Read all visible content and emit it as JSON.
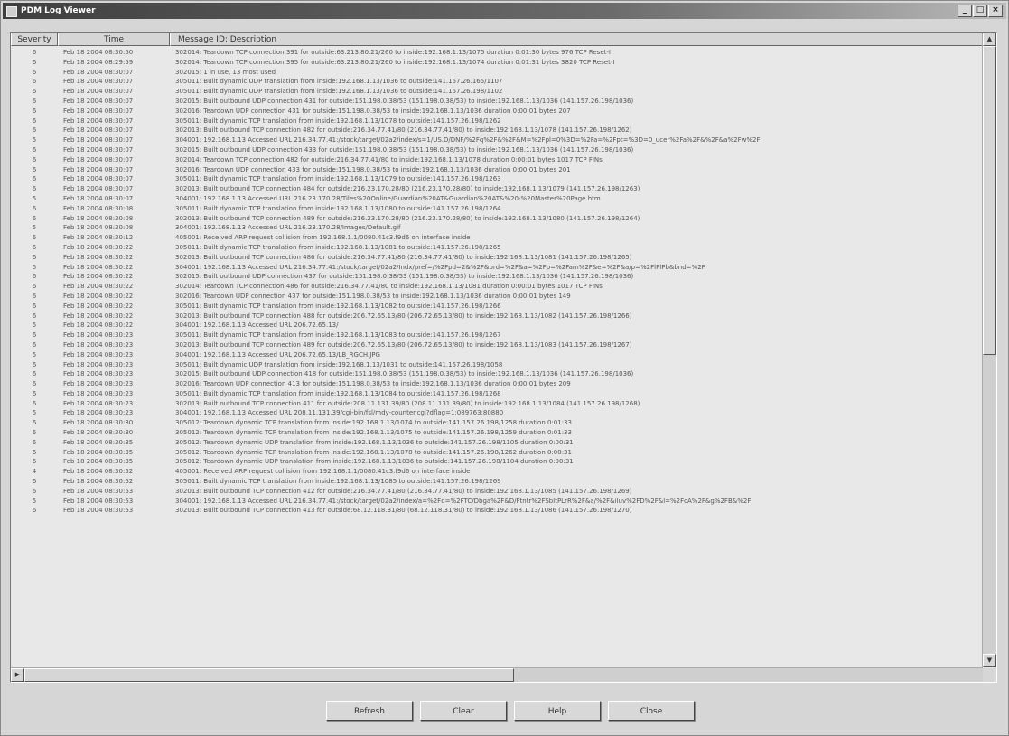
{
  "window": {
    "title": "PDM Log Viewer",
    "controls": {
      "minimize": "_",
      "maximize": "□",
      "close": "×"
    }
  },
  "columns": {
    "severity": "Severity",
    "time": "Time",
    "message": "Message ID: Description"
  },
  "rows": [
    {
      "sev": "6",
      "time": "Feb 18 2004 08:30:50",
      "msg": "302014: Teardown TCP connection 391 for outside:63.213.80.21/260 to inside:192.168.1.13/1075 duration 0:01:30 bytes 976 TCP Reset-I"
    },
    {
      "sev": "6",
      "time": "Feb 18 2004 08:29:59",
      "msg": "302014: Teardown TCP connection 395 for outside:63.213.80.21/260 to inside:192.168.1.13/1074 duration 0:01:31 bytes 3820 TCP Reset-I"
    },
    {
      "sev": "6",
      "time": "Feb 18 2004 08:30:07",
      "msg": "302015: 1 in use, 13 most used"
    },
    {
      "sev": "6",
      "time": "Feb 18 2004 08:30:07",
      "msg": "305011: Built dynamic UDP translation from inside:192.168.1.13/1036 to outside:141.157.26.165/1107"
    },
    {
      "sev": "6",
      "time": "Feb 18 2004 08:30:07",
      "msg": "305011: Built dynamic UDP translation from inside:192.168.1.13/1036 to outside:141.157.26.198/1102"
    },
    {
      "sev": "6",
      "time": "Feb 18 2004 08:30:07",
      "msg": "302015: Built outbound UDP connection 431 for outside:151.198.0.38/53 (151.198.0.38/53) to inside:192.168.1.13/1036 (141.157.26.198/1036)"
    },
    {
      "sev": "6",
      "time": "Feb 18 2004 08:30:07",
      "msg": "302016: Teardown UDP connection 431 for outside:151.198.0.38/53 to inside:192.168.1.13/1036 duration 0:00:01 bytes 207"
    },
    {
      "sev": "6",
      "time": "Feb 18 2004 08:30:07",
      "msg": "305011: Built dynamic TCP translation from inside:192.168.1.13/1078 to outside:141.157.26.198/1262"
    },
    {
      "sev": "6",
      "time": "Feb 18 2004 08:30:07",
      "msg": "302013: Built outbound TCP connection 482 for outside:216.34.77.41/80 (216.34.77.41/80) to inside:192.168.1.13/1078 (141.157.26.198/1262)"
    },
    {
      "sev": "5",
      "time": "Feb 18 2004 08:30:07",
      "msg": "304001: 192.168.1.13 Accessed URL 216.34.77.41:/stock/target/02a2/index/s=1/US.D/DNF/%2Fq%2F&%2F&M=%2Fpl=0%3D=%2Fa=%2Fpt=%3D=0_ucer%2Fa%2F&%2F&a%2Fw%2F"
    },
    {
      "sev": "6",
      "time": "Feb 18 2004 08:30:07",
      "msg": "302015: Built outbound UDP connection 433 for outside:151.198.0.38/53 (151.198.0.38/53) to inside:192.168.1.13/1036 (141.157.26.198/1036)"
    },
    {
      "sev": "6",
      "time": "Feb 18 2004 08:30:07",
      "msg": "302014: Teardown TCP connection 482 for outside:216.34.77.41/80 to inside:192.168.1.13/1078 duration 0:00:01 bytes 1017 TCP FINs"
    },
    {
      "sev": "6",
      "time": "Feb 18 2004 08:30:07",
      "msg": "302016: Teardown UDP connection 433 for outside:151.198.0.38/53 to inside:192.168.1.13/1036 duration 0:00:01 bytes 201"
    },
    {
      "sev": "6",
      "time": "Feb 18 2004 08:30:07",
      "msg": "305011: Built dynamic TCP translation from inside:192.168.1.13/1079 to outside:141.157.26.198/1263"
    },
    {
      "sev": "6",
      "time": "Feb 18 2004 08:30:07",
      "msg": "302013: Built outbound TCP connection 484 for outside:216.23.170.28/80 (216.23.170.28/80) to inside:192.168.1.13/1079 (141.157.26.198/1263)"
    },
    {
      "sev": "5",
      "time": "Feb 18 2004 08:30:07",
      "msg": "304001: 192.168.1.13 Accessed URL 216.23.170.28/Tiles%20Online/Guardian%20AT&Guardian%20AT&%20-%20Master%20Page.htm"
    },
    {
      "sev": "6",
      "time": "Feb 18 2004 08:30:08",
      "msg": "305011: Built dynamic TCP translation from inside:192.168.1.13/1080 to outside:141.157.26.198/1264"
    },
    {
      "sev": "6",
      "time": "Feb 18 2004 08:30:08",
      "msg": "302013: Built outbound TCP connection 489 for outside:216.23.170.28/80 (216.23.170.28/80) to inside:192.168.1.13/1080 (141.157.26.198/1264)"
    },
    {
      "sev": "5",
      "time": "Feb 18 2004 08:30:08",
      "msg": "304001: 192.168.1.13 Accessed URL 216.23.170.28/Images/Default.gif"
    },
    {
      "sev": "6",
      "time": "Feb 18 2004 08:30:12",
      "msg": "405001: Received ARP request collision from 192.168.1.1/0080.41c3.f9d6 on interface inside"
    },
    {
      "sev": "6",
      "time": "Feb 18 2004 08:30:22",
      "msg": "305011: Built dynamic TCP translation from inside:192.168.1.13/1081 to outside:141.157.26.198/1265"
    },
    {
      "sev": "6",
      "time": "Feb 18 2004 08:30:22",
      "msg": "302013: Built outbound TCP connection 486 for outside:216.34.77.41/80 (216.34.77.41/80) to inside:192.168.1.13/1081 (141.157.26.198/1265)"
    },
    {
      "sev": "5",
      "time": "Feb 18 2004 08:30:22",
      "msg": "304001: 192.168.1.13 Accessed URL 216.34.77.41:/stock/target/02a2/Indx/pref=/%2Fpd=2&%2F&prd=%2F&a=%2Fp=%2Fam%2F&e=%2F&a/p=%2FlPlPb&bnd=%2F"
    },
    {
      "sev": "6",
      "time": "Feb 18 2004 08:30:22",
      "msg": "302015: Built outbound UDP connection 437 for outside:151.198.0.38/53 (151.198.0.38/53) to inside:192.168.1.13/1036 (141.157.26.198/1036)"
    },
    {
      "sev": "6",
      "time": "Feb 18 2004 08:30:22",
      "msg": "302014: Teardown TCP connection 486 for outside:216.34.77.41/80 to inside:192.168.1.13/1081 duration 0:00:01 bytes 1017 TCP FINs"
    },
    {
      "sev": "6",
      "time": "Feb 18 2004 08:30:22",
      "msg": "302016: Teardown UDP connection 437 for outside:151.198.0.38/53 to inside:192.168.1.13/1036 duration 0:00:01 bytes 149"
    },
    {
      "sev": "6",
      "time": "Feb 18 2004 08:30:22",
      "msg": "305011: Built dynamic TCP translation from inside:192.168.1.13/1082 to outside:141.157.26.198/1266"
    },
    {
      "sev": "6",
      "time": "Feb 18 2004 08:30:22",
      "msg": "302013: Built outbound TCP connection 488 for outside:206.72.65.13/80 (206.72.65.13/80) to inside:192.168.1.13/1082 (141.157.26.198/1266)"
    },
    {
      "sev": "5",
      "time": "Feb 18 2004 08:30:22",
      "msg": "304001: 192.168.1.13 Accessed URL 206.72.65.13/"
    },
    {
      "sev": "6",
      "time": "Feb 18 2004 08:30:23",
      "msg": "305011: Built dynamic TCP translation from inside:192.168.1.13/1083 to outside:141.157.26.198/1267"
    },
    {
      "sev": "6",
      "time": "Feb 18 2004 08:30:23",
      "msg": "302013: Built outbound TCP connection 489 for outside:206.72.65.13/80 (206.72.65.13/80) to inside:192.168.1.13/1083 (141.157.26.198/1267)"
    },
    {
      "sev": "5",
      "time": "Feb 18 2004 08:30:23",
      "msg": "304001: 192.168.1.13 Accessed URL 206.72.65.13/LB_RGCH.JPG"
    },
    {
      "sev": "6",
      "time": "Feb 18 2004 08:30:23",
      "msg": "305011: Built dynamic UDP translation from inside:192.168.1.13/1031 to outside:141.157.26.198/1058"
    },
    {
      "sev": "6",
      "time": "Feb 18 2004 08:30:23",
      "msg": "302015: Built outbound UDP connection 418 for outside:151.198.0.38/53 (151.198.0.38/53) to inside:192.168.1.13/1036 (141.157.26.198/1036)"
    },
    {
      "sev": "6",
      "time": "Feb 18 2004 08:30:23",
      "msg": "302016: Teardown UDP connection 413 for outside:151.198.0.38/53 to inside:192.168.1.13/1036 duration 0:00:01 bytes 209"
    },
    {
      "sev": "6",
      "time": "Feb 18 2004 08:30:23",
      "msg": "305011: Built dynamic TCP translation from inside:192.168.1.13/1084 to outside:141.157.26.198/1268"
    },
    {
      "sev": "6",
      "time": "Feb 18 2004 08:30:23",
      "msg": "302013: Built outbound TCP connection 411 for outside:208.11.131.39/80 (208.11.131.39/80) to inside:192.168.1.13/1084 (141.157.26.198/1268)"
    },
    {
      "sev": "5",
      "time": "Feb 18 2004 08:30:23",
      "msg": "304001: 192.168.1.13 Accessed URL 208.11.131.39/cgi-bin/fsl/mdy-counter.cgi?dflag=1;089763;80880"
    },
    {
      "sev": "6",
      "time": "Feb 18 2004 08:30:30",
      "msg": "305012: Teardown dynamic TCP translation from inside:192.168.1.13/1074 to outside:141.157.26.198/1258 duration 0:01:33"
    },
    {
      "sev": "6",
      "time": "Feb 18 2004 08:30:30",
      "msg": "305012: Teardown dynamic TCP translation from inside:192.168.1.13/1075 to outside:141.157.26.198/1259 duration 0:01:33"
    },
    {
      "sev": "6",
      "time": "Feb 18 2004 08:30:35",
      "msg": "305012: Teardown dynamic UDP translation from inside:192.168.1.13/1036 to outside:141.157.26.198/1105 duration 0:00:31"
    },
    {
      "sev": "6",
      "time": "Feb 18 2004 08:30:35",
      "msg": "305012: Teardown dynamic TCP translation from inside:192.168.1.13/1078 to outside:141.157.26.198/1262 duration 0:00:31"
    },
    {
      "sev": "6",
      "time": "Feb 18 2004 08:30:35",
      "msg": "305012: Teardown dynamic UDP translation from inside:192.168.1.13/1036 to outside:141.157.26.198/1104 duration 0:00:31"
    },
    {
      "sev": "4",
      "time": "Feb 18 2004 08:30:52",
      "msg": "405001: Received ARP request collision from 192.168.1.1/0080.41c3.f9d6 on interface inside"
    },
    {
      "sev": "6",
      "time": "Feb 18 2004 08:30:52",
      "msg": "305011: Built dynamic TCP translation from inside:192.168.1.13/1085 to outside:141.157.26.198/1269"
    },
    {
      "sev": "6",
      "time": "Feb 18 2004 08:30:53",
      "msg": "302013: Built outbound TCP connection 412 for outside:216.34.77.41/80 (216.34.77.41/80) to inside:192.168.1.13/1085 (141.157.26.198/1269)"
    },
    {
      "sev": "5",
      "time": "Feb 18 2004 08:30:53",
      "msg": "304001: 192.168.1.13 Accessed URL 216.34.77.41:/stock/target/02a2/index/a=%2Fd=%2FTC/Dbga%2F&D/Ftntr%2FSbltPLrR%2F&a/%2F&iluv%2FD%2F&l=%2FcA%2F&g%2FB&%2F"
    },
    {
      "sev": "6",
      "time": "Feb 18 2004 08:30:53",
      "msg": "302013: Built outbound TCP connection 413 for outside:68.12.118.31/80 (68.12.118.31/80) to inside:192.168.1.13/1086 (141.157.26.198/1270)"
    }
  ],
  "scrollbar_glyphs": {
    "up": "▲",
    "down": "▼",
    "left": "◀",
    "right": "▶"
  },
  "buttons": {
    "refresh": "Refresh",
    "clear": "Clear",
    "help": "Help",
    "close": "Close"
  }
}
